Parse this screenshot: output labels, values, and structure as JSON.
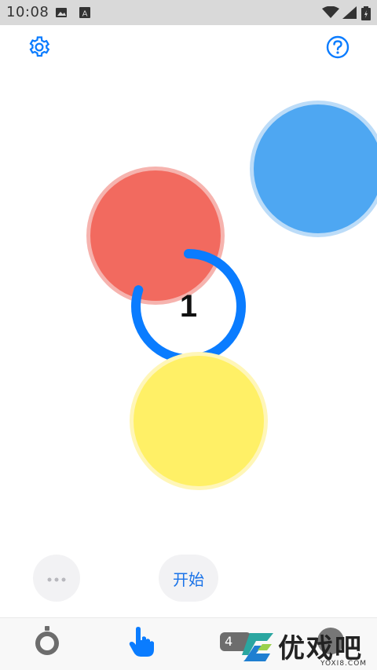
{
  "status_bar": {
    "time": "10:08",
    "icons": [
      "image-icon",
      "text-a-icon",
      "wifi-icon",
      "cell-signal-icon",
      "battery-icon"
    ]
  },
  "toolbar": {
    "settings_icon": "gear-icon",
    "help_icon": "help-circle-icon"
  },
  "game": {
    "countdown_value": "1",
    "countdown_progress": 0.8,
    "colors": {
      "red": "#f26a5f",
      "blue": "#4ea7f2",
      "yellow": "#fff066",
      "ring": "#0a7cff",
      "ring_track": "#cfe3fb"
    }
  },
  "controls": {
    "more_icon": "ellipsis-icon",
    "start_label": "开始"
  },
  "bottom_nav": {
    "items": [
      {
        "icon": "target-ring-icon"
      },
      {
        "icon": "tap-hand-icon"
      },
      {
        "icon": "badge-icon",
        "label": "4"
      },
      {
        "icon": "circle-icon"
      }
    ]
  },
  "watermark": {
    "text": "优戏吧",
    "subtext": "YOXI8.COM"
  }
}
